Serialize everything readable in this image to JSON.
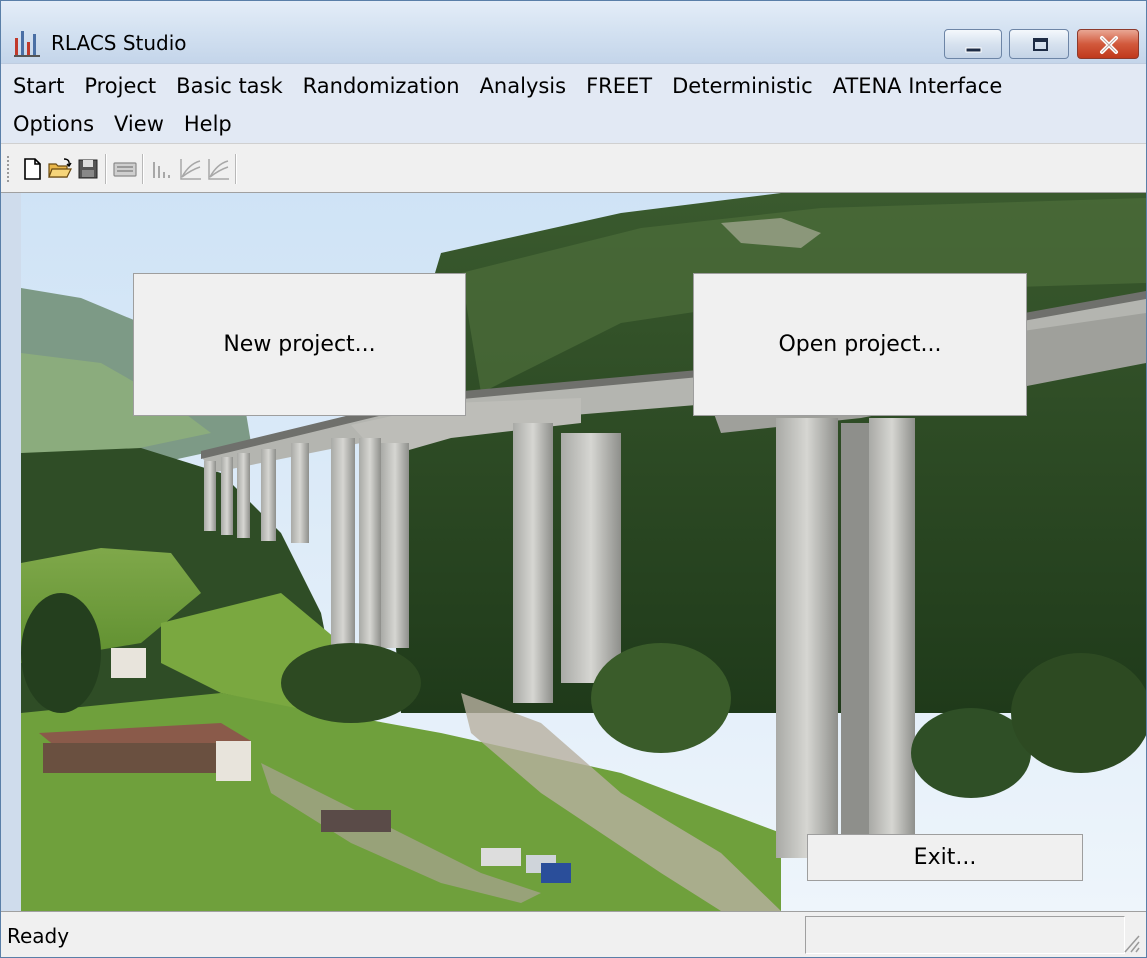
{
  "window": {
    "title": "RLACS Studio",
    "controls": {
      "minimize_icon": "minimize-icon",
      "maximize_icon": "maximize-icon",
      "close_icon": "close-icon"
    }
  },
  "menubar": {
    "row1": [
      "Start",
      "Project",
      "Basic task",
      "Randomization",
      "Analysis",
      "FREET",
      "Deterministic",
      "ATENA Interface"
    ],
    "row2": [
      "Options",
      "View",
      "Help"
    ]
  },
  "toolbar": {
    "buttons": [
      {
        "icon": "new-file-icon",
        "enabled": true
      },
      {
        "icon": "open-folder-icon",
        "enabled": true
      },
      {
        "icon": "save-icon",
        "enabled": true
      },
      {
        "icon": "keyboard-icon",
        "enabled": false
      },
      {
        "icon": "bar-chart-icon",
        "enabled": false
      },
      {
        "icon": "curve-chart-icon",
        "enabled": false
      },
      {
        "icon": "curve-chart-alt-icon",
        "enabled": false
      }
    ]
  },
  "main": {
    "background": "bridge-valley-photo",
    "new_project_label": "New project...",
    "open_project_label": "Open project...",
    "exit_label": "Exit..."
  },
  "statusbar": {
    "text": "Ready"
  },
  "colors": {
    "titlebar": "#d3e1f1",
    "menubar": "#e2e9f4",
    "close_button": "#c0391c",
    "button_face": "#f0f0f0"
  }
}
